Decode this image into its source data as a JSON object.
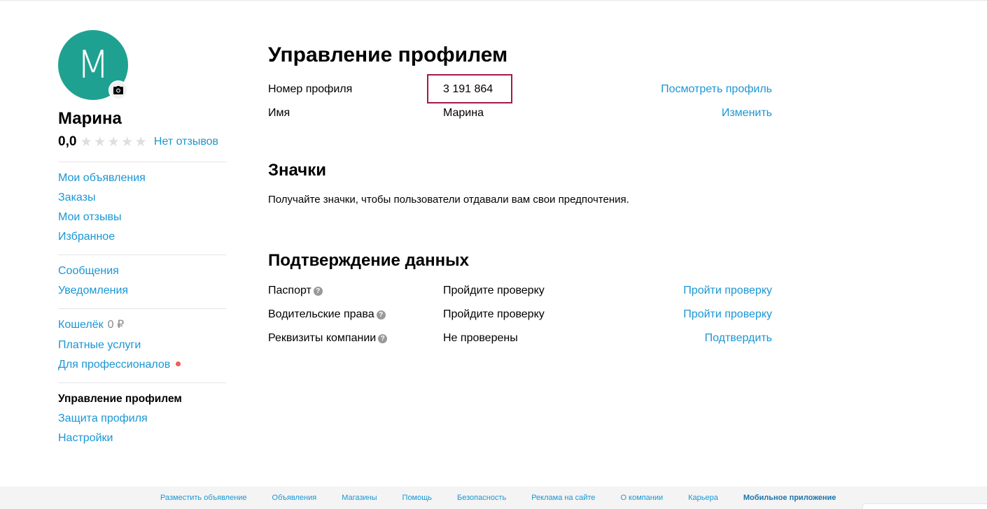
{
  "sidebar": {
    "avatar_letter": "М",
    "user_name": "Марина",
    "rating_value": "0,0",
    "rating_stars": 0,
    "reviews_link": "Нет отзывов",
    "group1": [
      "Мои объявления",
      "Заказы",
      "Мои отзывы",
      "Избранное"
    ],
    "group2": [
      "Сообщения",
      "Уведомления"
    ],
    "group3": {
      "wallet_label": "Кошелёк",
      "wallet_amount": "0 ₽",
      "paid_services": "Платные услуги",
      "for_pros": "Для профессионалов"
    },
    "group4": [
      "Управление профилем",
      "Защита профиля",
      "Настройки"
    ]
  },
  "main": {
    "title": "Управление профилем",
    "profile": [
      {
        "label": "Номер профиля",
        "value": "3 191 864",
        "action": "Посмотреть профиль"
      },
      {
        "label": "Имя",
        "value": "Марина",
        "action": "Изменить"
      }
    ],
    "badges": {
      "title": "Значки",
      "description": "Получайте значки, чтобы пользователи отдавали вам свои предпочтения."
    },
    "verification": {
      "title": "Подтверждение данных",
      "rows": [
        {
          "label": "Паспорт",
          "value": "Пройдите проверку",
          "action": "Пройти проверку"
        },
        {
          "label": "Водительские права",
          "value": "Пройдите проверку",
          "action": "Пройти проверку"
        },
        {
          "label": "Реквизиты компании",
          "value": "Не проверены",
          "action": "Подтвердить"
        }
      ]
    }
  },
  "footer": {
    "links": [
      "Разместить объявление",
      "Объявления",
      "Магазины",
      "Помощь",
      "Безопасность",
      "Реклама на сайте",
      "О компании",
      "Карьера",
      "Мобильное приложение"
    ]
  },
  "colors": {
    "link": "#1a96d4",
    "avatar_bg": "#1fa192",
    "highlight": "#a31b44",
    "notification_dot": "#f25a5a"
  },
  "icons": [
    "camera-icon",
    "star-icon",
    "question-icon",
    "notification-dot"
  ]
}
